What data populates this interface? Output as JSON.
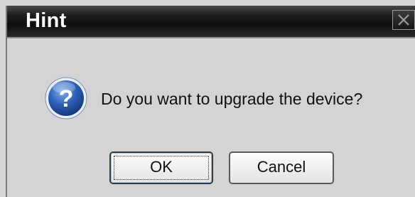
{
  "dialog": {
    "title": "Hint",
    "message": "Do you want to upgrade the device?",
    "icon": "question-icon",
    "close_icon": "close-icon",
    "buttons": {
      "ok": "OK",
      "cancel": "Cancel"
    }
  },
  "colors": {
    "titlebar": "#0d0d0d",
    "background": "#d4d4d4",
    "icon_blue": "#2d5fb8"
  }
}
